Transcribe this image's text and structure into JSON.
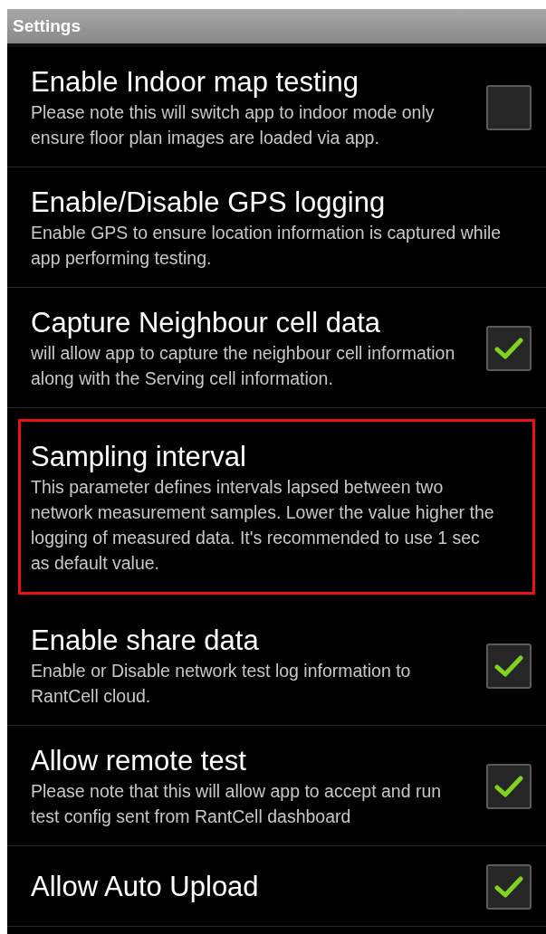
{
  "title": "Settings",
  "items": [
    {
      "kind": "checkbox",
      "title": "Enable Indoor map testing",
      "summary": "Please note this will switch app to indoor mode only ensure floor plan images are loaded via app.",
      "checked": false,
      "highlighted": false
    },
    {
      "kind": "text",
      "title": "Enable/Disable GPS logging",
      "summary": "Enable GPS to ensure location information is captured while app performing testing.",
      "highlighted": false
    },
    {
      "kind": "checkbox",
      "title": "Capture Neighbour cell data",
      "summary": "will allow app to capture the neighbour cell information along with the Serving cell information.",
      "checked": true,
      "highlighted": false
    },
    {
      "kind": "text",
      "title": "Sampling interval",
      "summary": "This parameter defines intervals lapsed between two network measurement samples. Lower the value higher the logging of measured data. It's recommended to use 1 sec as default value.",
      "highlighted": true
    },
    {
      "kind": "checkbox",
      "title": "Enable share data",
      "summary": "Enable or Disable network test log information to RantCell cloud.",
      "checked": true,
      "highlighted": false
    },
    {
      "kind": "checkbox",
      "title": "Allow remote test",
      "summary": "Please note that this will allow app to accept and run test config sent from RantCell dashboard",
      "checked": true,
      "highlighted": false
    },
    {
      "kind": "checkbox",
      "title": "Allow Auto Upload",
      "checked": true,
      "highlighted": false
    }
  ]
}
